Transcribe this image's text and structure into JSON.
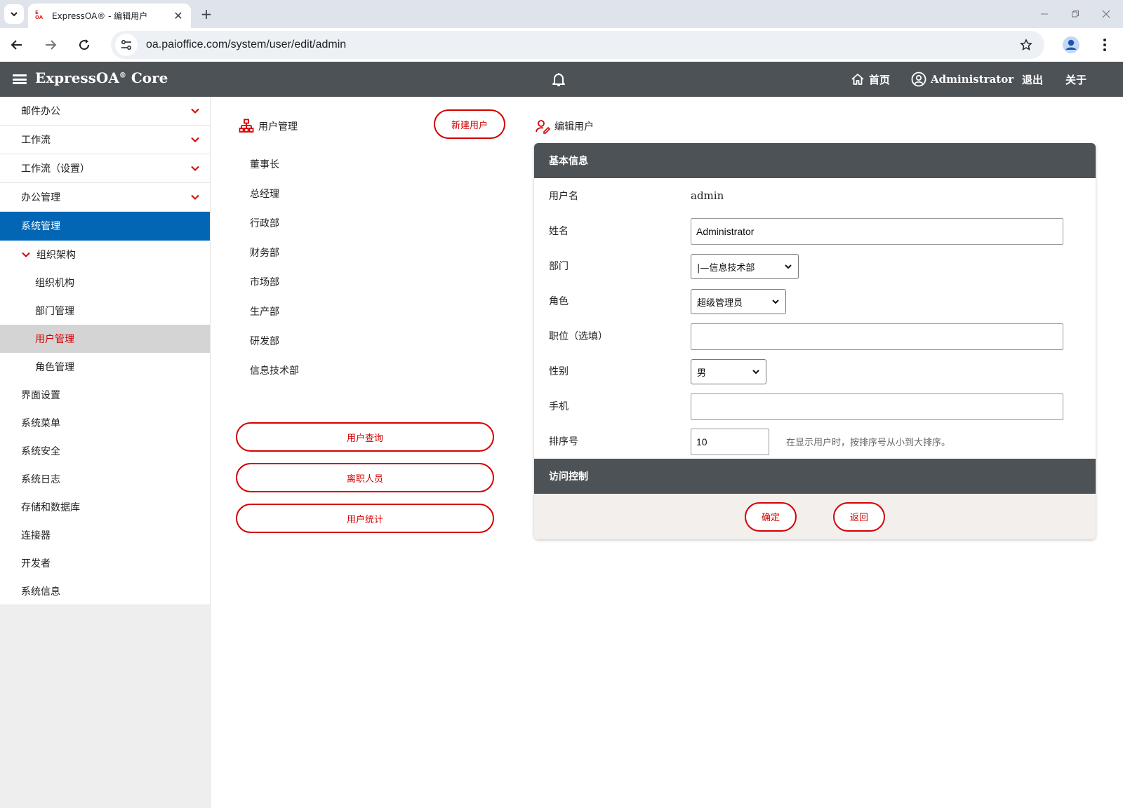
{
  "browser": {
    "tab_title": "ExpressOA® - 编辑用户",
    "favicon_top": "E",
    "favicon_bottom": "OA",
    "url": "oa.paioffice.com/system/user/edit/admin"
  },
  "header": {
    "brand": "ExpressOA",
    "brand_mark": "®",
    "brand_suffix": " Core",
    "home": "首页",
    "user": "Administrator",
    "logout": "退出",
    "about": "关于"
  },
  "sidebar": {
    "items": [
      {
        "label": "邮件办公"
      },
      {
        "label": "工作流"
      },
      {
        "label": "工作流（设置）"
      },
      {
        "label": "办公管理"
      }
    ],
    "active": "系统管理",
    "group": "组织架构",
    "subs": [
      "组织机构",
      "部门管理",
      "用户管理",
      "角色管理"
    ],
    "rest": [
      "界面设置",
      "系统菜单",
      "系统安全",
      "系统日志",
      "存储和数据库",
      "连接器",
      "开发者",
      "系统信息"
    ]
  },
  "middle": {
    "title": "用户管理",
    "new_user": "新建用户",
    "departments": [
      "董事长",
      "总经理",
      "行政部",
      "财务部",
      "市场部",
      "生产部",
      "研发部",
      "信息技术部"
    ],
    "buttons": [
      "用户查询",
      "离职人员",
      "用户统计"
    ]
  },
  "edit": {
    "title": "编辑用户",
    "section_basic": "基本信息",
    "section_access": "访问控制",
    "username_label": "用户名",
    "username": "admin",
    "name_label": "姓名",
    "name_value": "Administrator",
    "dept_label": "部门",
    "dept_value": "|—信息技术部",
    "role_label": "角色",
    "role_value": "超级管理员",
    "position_label": "职位（选填）",
    "position_value": "",
    "gender_label": "性别",
    "gender_value": "男",
    "phone_label": "手机",
    "phone_value": "",
    "order_label": "排序号",
    "order_value": "10",
    "order_hint": "在显示用户时，按排序号从小到大排序。",
    "confirm": "确定",
    "back": "返回"
  },
  "colors": {
    "accent": "#d40000",
    "active_blue": "#0366b5",
    "header_gray": "#4d5257"
  }
}
